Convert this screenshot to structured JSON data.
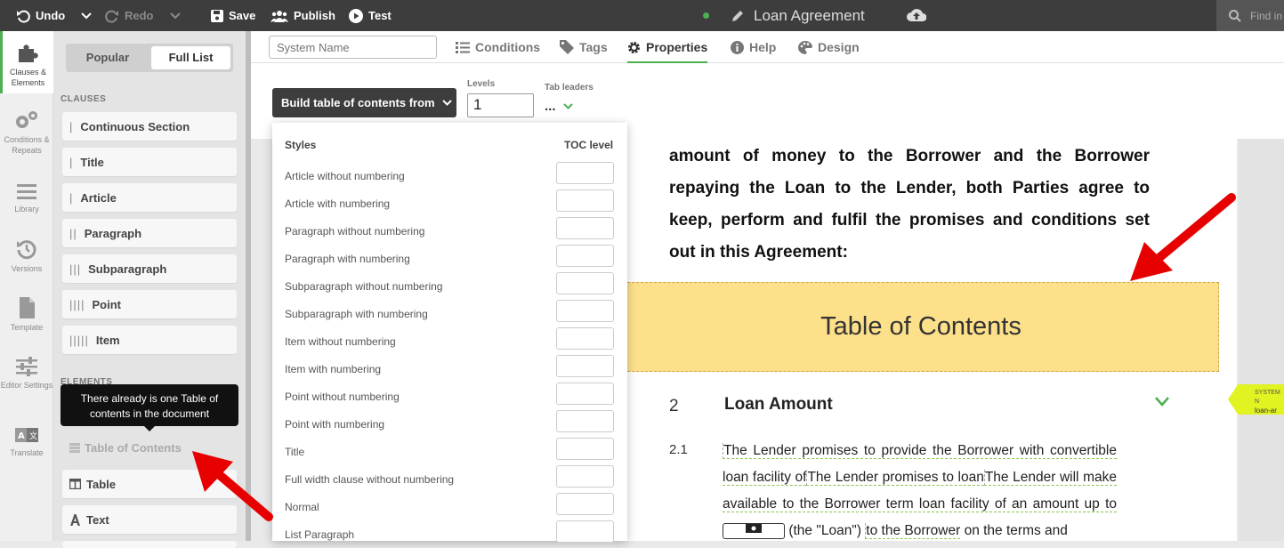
{
  "toolbar": {
    "undo": "Undo",
    "redo": "Redo",
    "save": "Save",
    "publish": "Publish",
    "test": "Test",
    "doc_title": "Loan Agreement",
    "find_placeholder": "Find in"
  },
  "iconbar": [
    {
      "label": "Clauses & Elements",
      "icon": "puzzle-icon",
      "active": true
    },
    {
      "label": "Conditions & Repeats",
      "icon": "gears-icon"
    },
    {
      "label": "Library",
      "icon": "list-icon"
    },
    {
      "label": "Versions",
      "icon": "history-icon"
    },
    {
      "label": "Template",
      "icon": "file-icon"
    },
    {
      "label": "Editor Settings",
      "icon": "sliders-icon"
    },
    {
      "label": "Translate",
      "icon": "translate-icon"
    }
  ],
  "palette": {
    "tab_popular": "Popular",
    "tab_full": "Full List",
    "clauses_heading": "CLAUSES",
    "clauses": [
      {
        "bars": "|",
        "label": "Continuous Section"
      },
      {
        "bars": "|",
        "label": "Title"
      },
      {
        "bars": "|",
        "label": "Article"
      },
      {
        "bars": "||",
        "label": "Paragraph"
      },
      {
        "bars": "|||",
        "label": "Subparagraph"
      },
      {
        "bars": "||||",
        "label": "Point"
      },
      {
        "bars": "|||||",
        "label": "Item"
      }
    ],
    "elements_heading": "ELEMENTS",
    "tooltip": "There already is one Table of contents in the document",
    "elements": [
      {
        "label": "Table of Contents",
        "disabled": true
      },
      {
        "label": "Table"
      },
      {
        "label": "Text"
      }
    ]
  },
  "props": {
    "system_name_placeholder": "System Name",
    "tabs": [
      {
        "label": "Conditions",
        "icon": "list-icon"
      },
      {
        "label": "Tags",
        "icon": "tag-icon"
      },
      {
        "label": "Properties",
        "icon": "gear-icon",
        "active": true
      },
      {
        "label": "Help",
        "icon": "info-icon"
      },
      {
        "label": "Design",
        "icon": "palette-icon"
      }
    ],
    "build_label": "Build table of contents from",
    "levels_label": "Levels",
    "levels_value": "1",
    "tab_leaders_label": "Tab leaders",
    "tab_leaders_value": "..."
  },
  "dropdown": {
    "col_styles": "Styles",
    "col_level": "TOC level",
    "rows": [
      "Article without numbering",
      "Article with numbering",
      "Paragraph without numbering",
      "Paragraph with numbering",
      "Subparagraph without numbering",
      "Subparagraph with numbering",
      "Item without numbering",
      "Item with numbering",
      "Point without numbering",
      "Point with numbering",
      "Title",
      "Full width clause without numbering",
      "Normal",
      "List Paragraph"
    ]
  },
  "document": {
    "paragraph": "amount of money to the Borrower and the Borrower repaying the Loan to the Lender, both Parties agree to keep, perform and fulfil the promises and conditions set out in this Agreement:",
    "toc_title": "Table of Contents",
    "section_number": "2",
    "section_title": "Loan Amount",
    "subsection_number": "2.1",
    "clause_part1": "The Lender promises to provide the Borrower with convertible loan facility of",
    "clause_part2": "The Lender promises to loan",
    "clause_part3": "The Lender will make available to the Borrower term loan facility of an amount up to",
    "clause_part4": "(the \"Loan\")",
    "clause_part5": "to the Borrower",
    "clause_part6": "on the terms and",
    "side_tag_title": "SYSTEM N",
    "side_tag_value": "loan-ar"
  },
  "colors": {
    "accent": "#4caf50",
    "toc_bg": "#fde08a",
    "arrow": "#e60000",
    "tag": "#e1f321"
  }
}
